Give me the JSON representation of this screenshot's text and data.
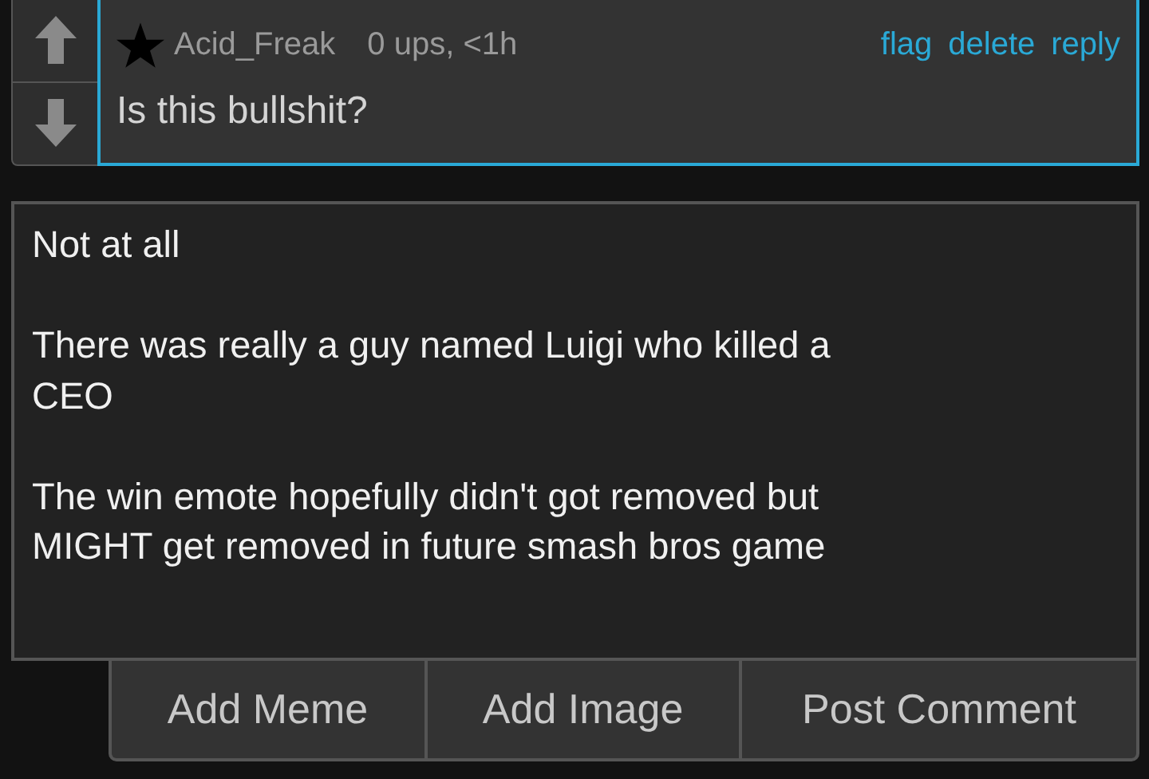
{
  "comment": {
    "votes": [
      {
        "kind": "up",
        "selected": false
      },
      {
        "kind": "down",
        "selected": false
      }
    ],
    "author": "Acid_Freak",
    "meta": "0 ups, <1h",
    "actions": [
      "flag",
      "delete",
      "reply"
    ],
    "text": "Is this bullshit?"
  },
  "reply_field": {
    "value": "Not at all\n\nThere was really a guy named Luigi who killed a\nCEO\n\nThe win emote hopefully didn't got removed but\nMIGHT get removed in future smash bros game"
  },
  "buttons": [
    "Add Meme",
    "Add Image",
    "Post Comment"
  ]
}
